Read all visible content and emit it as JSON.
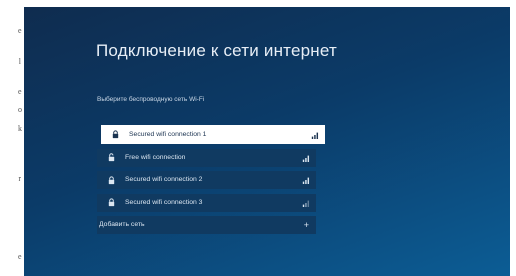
{
  "left_strip": [
    "e",
    "l",
    "e",
    "o",
    "k",
    "r",
    "",
    "e"
  ],
  "page": {
    "title": "Подключение к сети интернет",
    "subtitle": "Выберите беспроводную сеть Wi-Fi"
  },
  "networks": [
    {
      "name": "Secured wifi connection 1",
      "icon": "lock-icon",
      "selected": true
    },
    {
      "name": "Free wifi connection",
      "icon": "unlock-icon",
      "selected": false
    },
    {
      "name": "Secured wifi connection 2",
      "icon": "lock-icon",
      "selected": false
    },
    {
      "name": "Secured wifi connection 3",
      "icon": "lock-icon",
      "selected": false
    }
  ],
  "add_network": {
    "label": "Добавить сеть",
    "icon": "plus-icon",
    "symbol": "+"
  },
  "colors": {
    "background_start": "#0f2c4f",
    "background_end": "#0c5d95",
    "row": "#103a61",
    "selected_row": "#ffffff"
  }
}
